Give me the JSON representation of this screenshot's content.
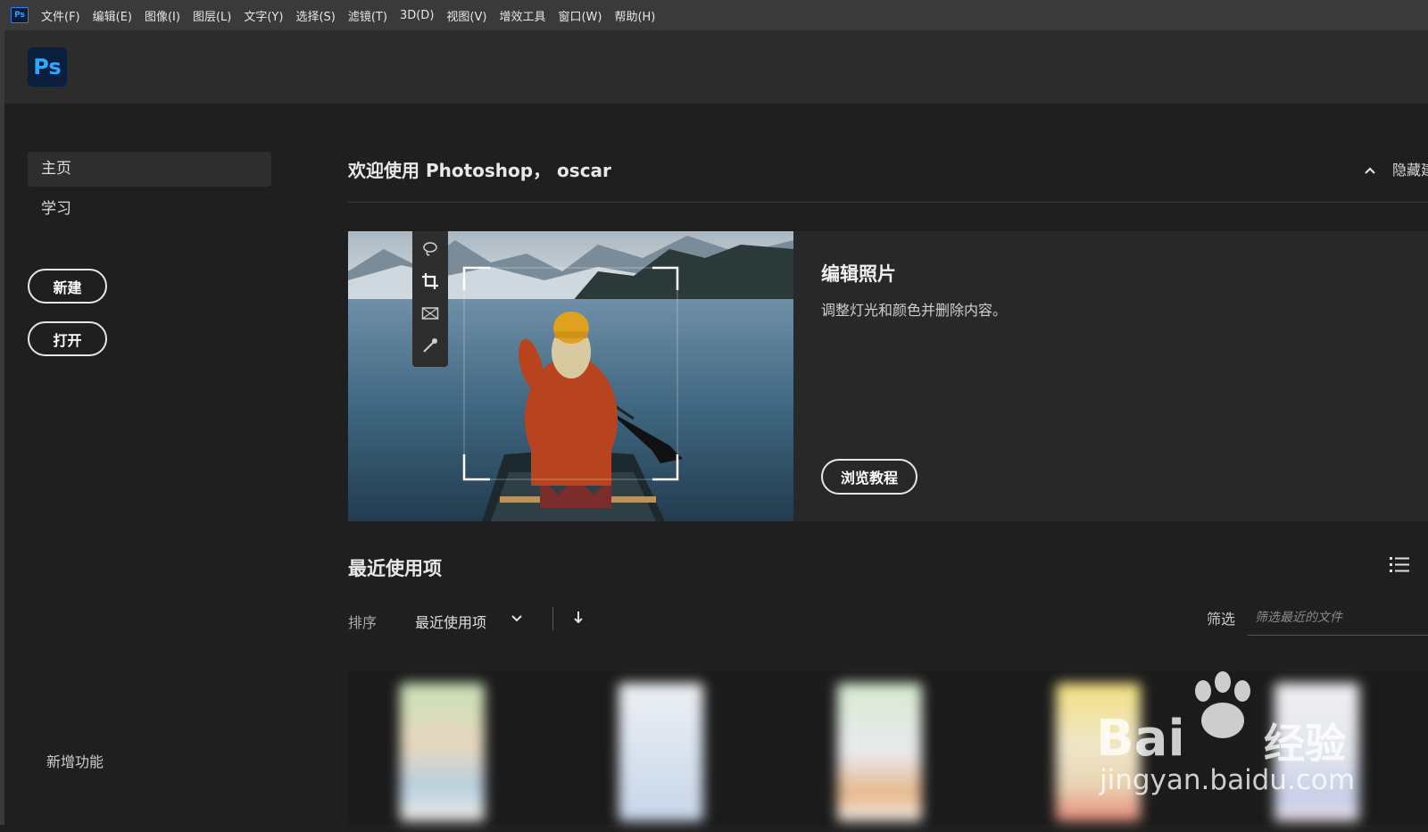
{
  "menubar": {
    "app_icon_label": "Ps",
    "items": [
      "文件(F)",
      "编辑(E)",
      "图像(I)",
      "图层(L)",
      "文字(Y)",
      "选择(S)",
      "滤镜(T)",
      "3D(D)",
      "视图(V)",
      "增效工具",
      "窗口(W)",
      "帮助(H)"
    ]
  },
  "header": {
    "logo_text": "Ps"
  },
  "sidebar": {
    "items": [
      {
        "label": "主页",
        "active": true
      },
      {
        "label": "学习",
        "active": false
      }
    ],
    "new_button": "新建",
    "open_button": "打开",
    "new_features": "新增功能"
  },
  "main": {
    "welcome": "欢迎使用 Photoshop， oscar",
    "collapse_label": "隐藏建",
    "feature": {
      "title": "编辑照片",
      "description": "调整灯光和颜色并删除内容。",
      "button": "浏览教程",
      "tools": [
        "lasso-icon",
        "crop-icon",
        "frame-icon",
        "eyedropper-icon"
      ]
    },
    "recent": {
      "title": "最近使用项",
      "sort_label": "排序",
      "sort_value": "最近使用项",
      "filter_label": "筛选",
      "filter_placeholder": "筛选最近的文件"
    }
  },
  "watermark": {
    "brand": "Bai",
    "brand2": "经验",
    "url": "jingyan.baidu.com"
  },
  "colors": {
    "accent": "#31a8ff",
    "background": "#1f1f1f",
    "header": "#2c2c2c",
    "menubar": "#3a3a3a"
  }
}
